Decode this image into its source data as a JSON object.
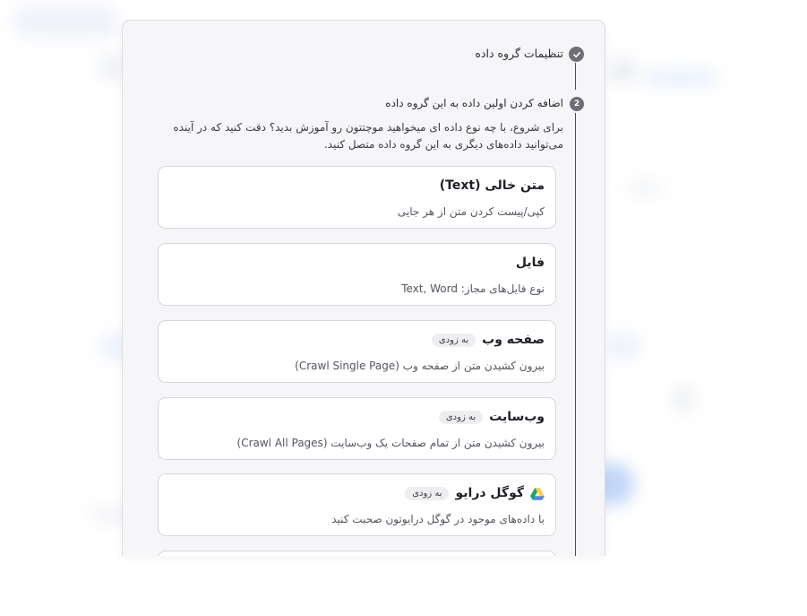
{
  "steps": [
    {
      "title": "تنظیمات گروه داده",
      "state": "done",
      "icon": "check-icon"
    },
    {
      "title": "اضافه کردن اولین داده به این گروه داده",
      "number": "2",
      "state": "active"
    }
  ],
  "description_line1": "برای شروع، با چه نوع داده ای میخواهید موچتتون رو آموزش بدید؟ دقت کنید که در آینده",
  "description_line2": "می‌توانید داده‌های دیگری به این گروه داده متصل کنید.",
  "options": [
    {
      "title": "متن خالی (Text)",
      "subtitle": "کپی/پیست کردن متن از هر جایی"
    },
    {
      "title": "فایل",
      "subtitle": "نوع فایل‌های مجاز: Text, Word"
    },
    {
      "title": "صفحه وب",
      "badge": "به زودی",
      "subtitle": "بیرون کشیدن متن از صفحه وب (Crawl Single Page)"
    },
    {
      "title": "وب‌سایت",
      "badge": "به زودی",
      "subtitle": "بیرون کشیدن متن از تمام صفحات یک وب‌سایت (Crawl All Pages)"
    },
    {
      "title": "گوگل درایو",
      "badge": "به زودی",
      "subtitle": "با داده‌های موجود در گوگل درایوتون صحبت کنید",
      "icon": "google-drive-icon"
    }
  ],
  "colors": {
    "accent": "#6e6e78",
    "drive_green": "#1fa463",
    "drive_yellow": "#ffd04b",
    "drive_blue": "#4688f4"
  }
}
